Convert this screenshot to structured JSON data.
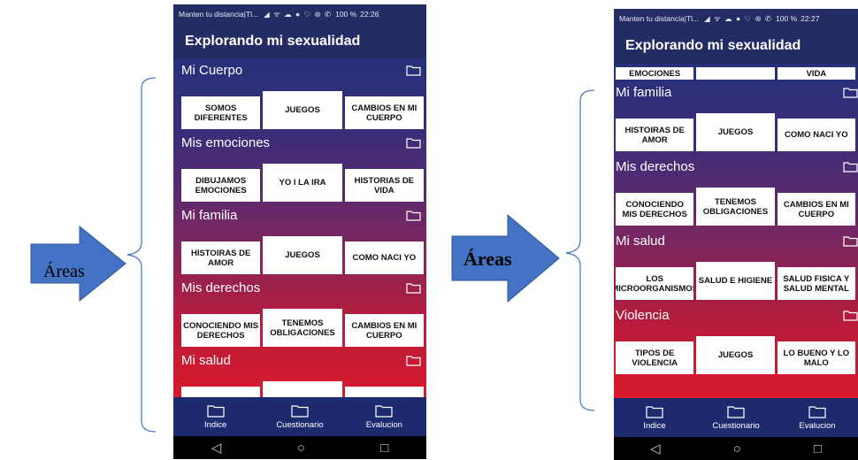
{
  "annotation": {
    "label": "Áreas",
    "arrow_color": "#4472c4",
    "brace_color": "#4472c4"
  },
  "phone_left": {
    "status": {
      "carrier": "Manten tu distancia|Tl...",
      "icons": "◢ ᯤ ☁ ● ♡ ⊚ ✆",
      "battery": "100 %",
      "time": "22:26"
    },
    "title": "Explorando mi sexualidad",
    "sections": [
      {
        "title": "Mi Cuerpo",
        "cards": [
          "SOMOS DIFERENTES",
          "JUEGOS",
          "CAMBIOS EN MI CUERPO"
        ]
      },
      {
        "title": "Mis emociones",
        "cards": [
          "DIBUJAMOS EMOCIONES",
          "YO I LA IRA",
          "HISTORIAS DE VIDA"
        ]
      },
      {
        "title": "Mi familia",
        "cards": [
          "HISTOIRAS DE AMOR",
          "JUEGOS",
          "COMO NACI YO"
        ]
      },
      {
        "title": "Mis derechos",
        "cards": [
          "CONOCIENDO MIS DERECHOS",
          "TENEMOS OBLIGACIONES",
          "CAMBIOS EN MI CUERPO"
        ]
      },
      {
        "title": "Mi salud",
        "cards": [
          "",
          "",
          ""
        ]
      }
    ],
    "nav": [
      "Indice",
      "Cuestionario",
      "Evalucion"
    ]
  },
  "phone_right": {
    "status": {
      "carrier": "Manten tu distancia|Tl...",
      "icons": "◢ ᯤ ☁ ● ♡ ⊚ ✆",
      "battery": "100 %",
      "time": "22:27"
    },
    "title": "Explorando mi sexualidad",
    "top_partial_cards": [
      "EMOCIONES",
      "",
      "VIDA"
    ],
    "sections": [
      {
        "title": "Mi familia",
        "cards": [
          "HISTOIRAS DE AMOR",
          "JUEGOS",
          "COMO NACI YO"
        ]
      },
      {
        "title": "Mis derechos",
        "cards": [
          "CONOCIENDO MIS DERECHOS",
          "TENEMOS OBLIGACIONES",
          "CAMBIOS EN MI CUERPO"
        ]
      },
      {
        "title": "Mi salud",
        "cards": [
          "LOS MICROORGANISMOS",
          "SALUD E HIGIENE",
          "SALUD FISICA Y SALUD MENTAL"
        ]
      },
      {
        "title": "Violencia",
        "cards": [
          "TIPOS DE VIOLENCIA",
          "JUEGOS",
          "LO BUENO Y LO MALO"
        ]
      }
    ],
    "nav": [
      "Indice",
      "Cuestionario",
      "Evalucion"
    ]
  },
  "system_nav": {
    "back": "◁",
    "home": "○",
    "recents": "□"
  }
}
